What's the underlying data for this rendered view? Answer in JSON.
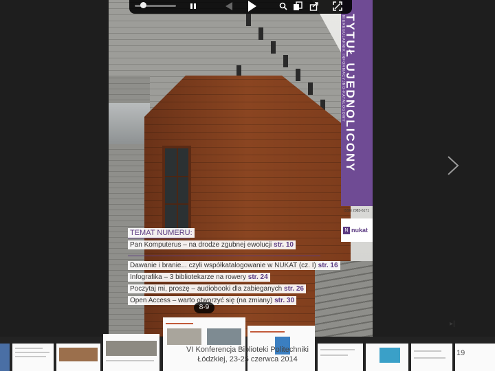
{
  "viewer": {
    "toolbar": {
      "play_icon": "play-icon",
      "prev_icon": "prev-page-icon",
      "controls": [
        "pause-icon",
        "prev-page-icon",
        "play-icon",
        "search-icon",
        "thumbnails-icon",
        "share-icon",
        "fullscreen-icon"
      ]
    },
    "page_badge": "8-9",
    "caption_line1": "VI Konferencja Biblioteki Politechniki",
    "caption_line2": "Łódzkiej, 23-25 czerwca 2014",
    "thumb_page_number": "19"
  },
  "cover": {
    "title": "TYTUŁ UJEDNOLICONY",
    "subtitle": "NIEREGULARNIK INFORMACYJNO-KATALOGOWY",
    "issn": "ISSN 2083-6171",
    "logo_text": "nukat",
    "logo_mark": "N",
    "toc_heading": "TEMAT NUMERU:",
    "toc": [
      {
        "text": "Pan Komputerus – na drodze zgubnej ewolucji",
        "page": "str. 10"
      },
      {
        "text": "Dawanie i branie... czyli współkatalogowanie w NUKAT (cz. I)",
        "page": "str. 16"
      },
      {
        "text": "Infografika – 3 bibliotekarze na rowery",
        "page": "str. 24"
      },
      {
        "text": "Poczytaj mi, proszę – audiobooki dla zabieganych",
        "page": "str. 26"
      },
      {
        "text": "Open Access – warto otworzyć się (na zmiany)",
        "page": "str. 30"
      }
    ]
  },
  "colors": {
    "accent": "#6f4b94",
    "background": "#1e1e1e",
    "toolbar": "#000000"
  }
}
